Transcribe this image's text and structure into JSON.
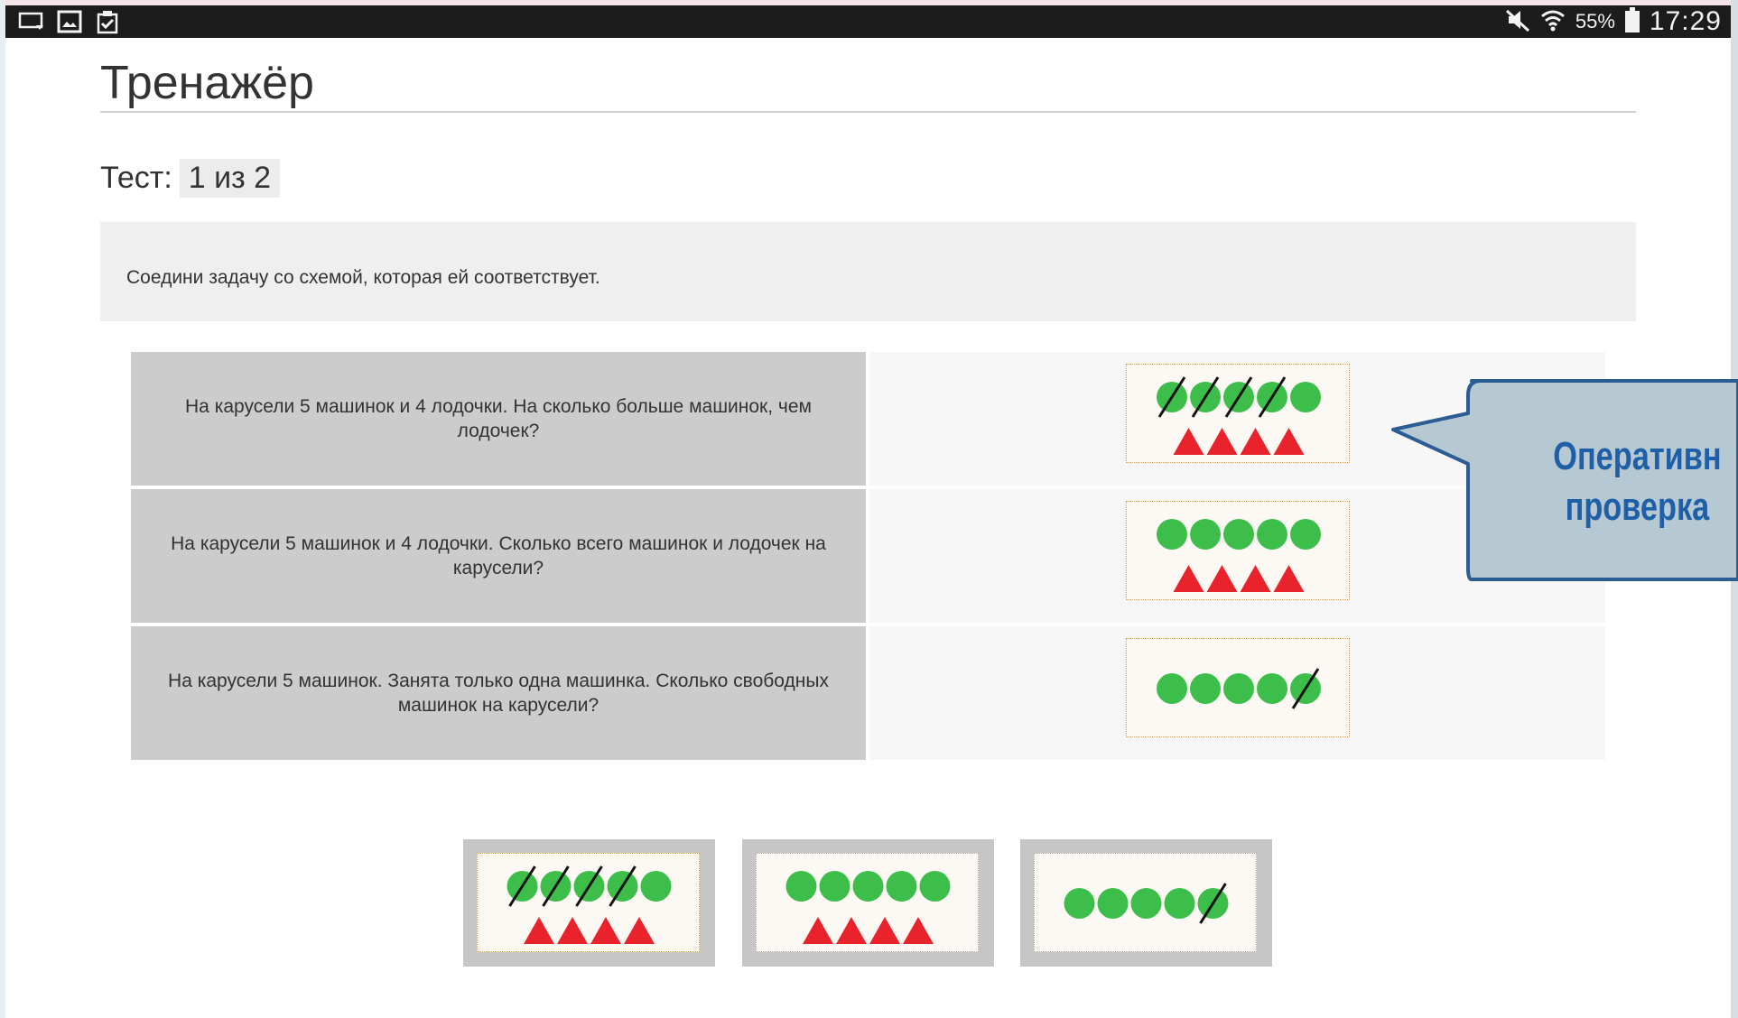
{
  "status_bar": {
    "battery_percent": "55%",
    "time": "17:29",
    "left_icons": [
      "cast-icon",
      "image-icon",
      "clipboard-check-icon"
    ],
    "right_icons": [
      "mute-icon",
      "wifi-icon",
      "battery-icon"
    ]
  },
  "page": {
    "title": "Тренажёр",
    "test_label": "Тест:",
    "test_counter": "1 из 2",
    "instruction": "Соедини задачу со схемой, которая ей соответствует."
  },
  "tasks": [
    {
      "text": "На карусели 5 машинок и 4 лодочки. На сколько больше машинок, чем лодочек?",
      "scheme": {
        "circles": 5,
        "crossed_circles": 4,
        "triangles": 4
      }
    },
    {
      "text": "На карусели 5 машинок и 4 лодочки. Сколько всего машинок и лодочек на карусели?",
      "scheme": {
        "circles": 5,
        "crossed_circles": 0,
        "triangles": 4
      }
    },
    {
      "text": "На карусели 5 машинок. Занята только одна машинка. Сколько свободных машинок на карусели?",
      "scheme": {
        "circles": 5,
        "crossed_circles": 1,
        "triangles": 0
      }
    }
  ],
  "answer_cards": [
    {
      "circles": 5,
      "crossed_circles": 4,
      "triangles": 4
    },
    {
      "circles": 5,
      "crossed_circles": 0,
      "triangles": 4
    },
    {
      "circles": 5,
      "crossed_circles": 1,
      "triangles": 0
    }
  ],
  "callout": {
    "line1": "Оперативн",
    "line2": "проверка"
  },
  "colors": {
    "circle": "#3dbe4a",
    "triangle": "#e8232b",
    "callout_fill": "#b6c9d3",
    "callout_border": "#2b5c93",
    "callout_text": "#1f5fa8"
  }
}
